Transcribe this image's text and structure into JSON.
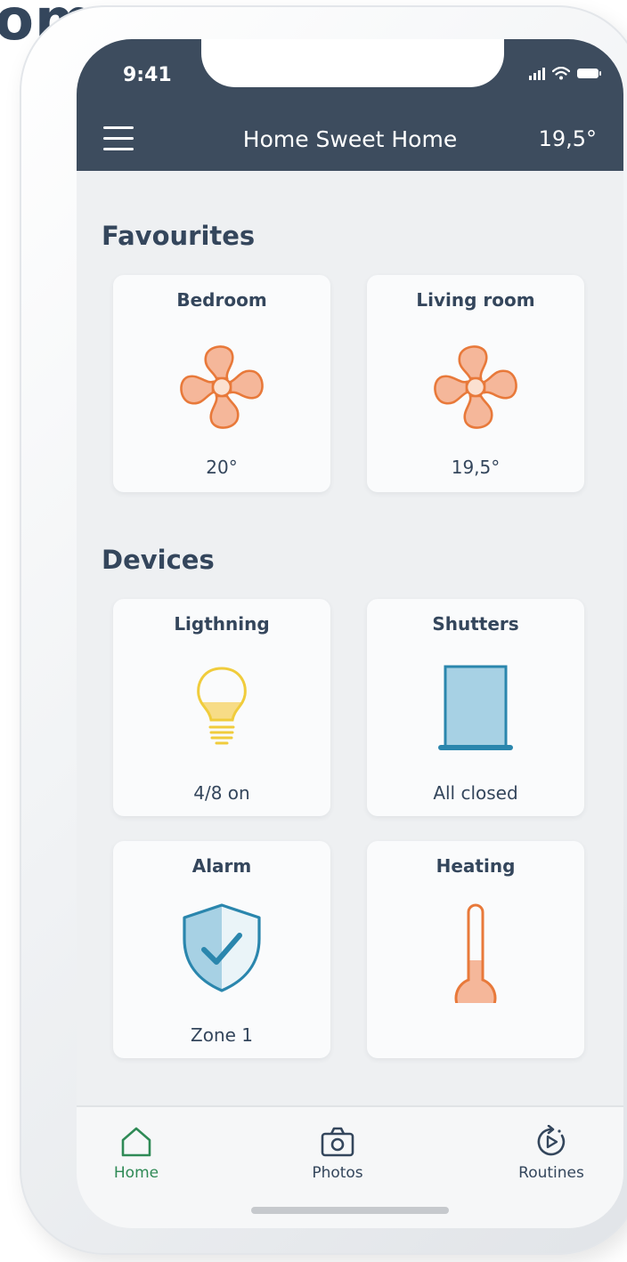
{
  "corner_text": "om",
  "status_bar": {
    "time": "9:41"
  },
  "header": {
    "title": "Home Sweet Home",
    "temperature": "19,5°"
  },
  "favourites": {
    "title": "Favourites",
    "cards": [
      {
        "name": "Bedroom",
        "status": "20°",
        "icon": "fan-icon"
      },
      {
        "name": "Living room",
        "status": "19,5°",
        "icon": "fan-icon"
      }
    ]
  },
  "devices": {
    "title": "Devices",
    "cards": [
      {
        "name": "Ligthning",
        "status": "4/8 on",
        "icon": "lightbulb-icon"
      },
      {
        "name": "Shutters",
        "status": "All closed",
        "icon": "shutter-icon"
      },
      {
        "name": "Alarm",
        "status": "Zone 1",
        "icon": "shield-check-icon"
      },
      {
        "name": "Heating",
        "status": "",
        "icon": "thermometer-icon"
      }
    ]
  },
  "tabbar": {
    "tabs": [
      {
        "label": "Home",
        "icon": "home-icon",
        "active": true
      },
      {
        "label": "Photos",
        "icon": "camera-icon",
        "active": false
      },
      {
        "label": "Routines",
        "icon": "routine-icon",
        "active": false
      }
    ]
  },
  "colors": {
    "header_bg": "#3d4c5e",
    "text": "#34465c",
    "accent_orange": "#e8793a",
    "orange_fill": "#f5b79a",
    "shutter_blue": "#2a86ad",
    "bulb_yellow": "#f0cc3c",
    "active_green": "#2f8a56"
  }
}
